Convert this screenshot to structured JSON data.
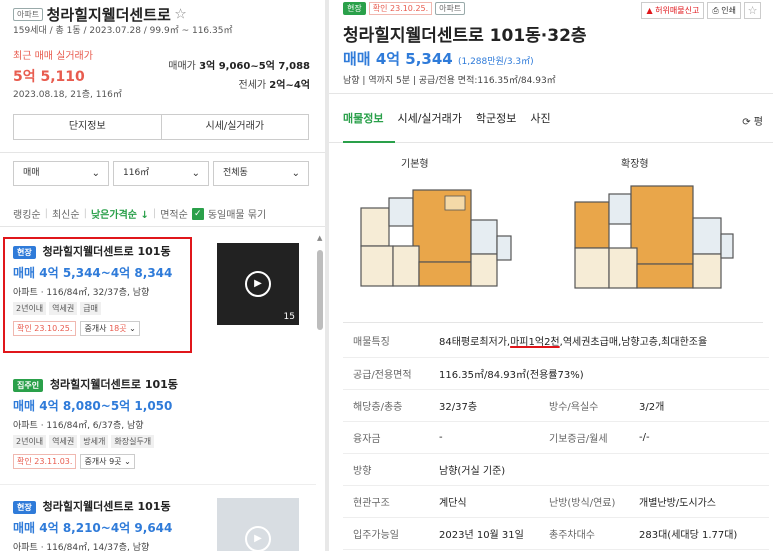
{
  "complex": {
    "type_tag": "아파트",
    "name": "청라힐지웰더센트로",
    "star": "☆",
    "summary": "159세대 / 총 1동 / 2023.07.28 / 99.9㎡ ~ 116.35㎡",
    "recent_label": "최근 매매 실거래가",
    "recent_price": "5억 5,110",
    "recent_date": "2023.08.18, 21층, 116㎡",
    "sale_label": "매매가",
    "sale_range": "3억 9,060~5억 7,088",
    "rent_label": "전세가",
    "rent_range": "2억~4억",
    "btn_info": "단지정보",
    "btn_price": "시세/실거래가"
  },
  "filters": {
    "trade": "매매",
    "area": "116㎡",
    "building": "전체동"
  },
  "sorts": {
    "ranking": "랭킹순",
    "latest": "최신순",
    "low_price": "낮은가격순",
    "low_price_arrow": "↓",
    "area": "면적순",
    "group": "동일매물 묶기"
  },
  "listings": [
    {
      "tag": "현장",
      "title": "청라힐지웰더센트로 101동",
      "price": "매매 4억 5,344~4억 8,344",
      "info": "아파트 · 116/84㎡, 32/37층, 남향",
      "chips": [
        "2년이내",
        "역세권",
        "급매"
      ],
      "confirm": "확인 23.10.25.",
      "agent_label": "중개사",
      "agent_count": "18곳",
      "thumb_count": "15"
    },
    {
      "tag": "집주인",
      "title": "청라힐지웰더센트로 101동",
      "price": "매매 4억 8,080~5억 1,050",
      "info": "아파트 · 116/84㎡, 6/37층, 남향",
      "chips": [
        "2년이내",
        "역세권",
        "방세개",
        "화장실두개"
      ],
      "confirm": "확인 23.11.03.",
      "agent_label": "중개사",
      "agent_count": "9곳"
    },
    {
      "tag": "현장",
      "title": "청라힐지웰더센트로 101동",
      "price": "매매 4억 8,210~4억 9,644",
      "info": "아파트 · 116/84㎡, 14/37층, 남향"
    }
  ],
  "detail": {
    "tag_site": "현장",
    "tag_confirm": "확인 23.10.25.",
    "tag_type": "아파트",
    "report": "허위매물신고",
    "print": "인쇄",
    "star": "☆",
    "title": "청라힐지웰더센트로 101동·32층",
    "price": "매매 4억 5,344",
    "price_per": "(1,288만원/3.3㎡)",
    "meta": "남향 | 역까지 5분 | 공급/전용 면적:116.35㎡/84.93㎡",
    "tabs": [
      "매물정보",
      "시세/실거래가",
      "학군정보",
      "사진"
    ],
    "pyeong": "평",
    "plan_basic": "기본형",
    "plan_ext": "확장형",
    "rows": [
      {
        "k": "매물특징",
        "v_pre": "84태평로최저가,",
        "v_hl": "마피1억2천",
        "v_post": ",역세권초급매,남향고층,최대한조율"
      },
      {
        "k": "공급/전용면적",
        "v": "116.35㎡/84.93㎡(전용률73%)"
      },
      {
        "k": "해당층/총층",
        "v": "32/37층",
        "k2": "방수/욕실수",
        "v2": "3/2개"
      },
      {
        "k": "융자금",
        "v": "-",
        "k2": "기보증금/월세",
        "v2": "-/-"
      },
      {
        "k": "방향",
        "v": "남향(거실 기준)"
      },
      {
        "k": "현관구조",
        "v": "계단식",
        "k2": "난방(방식/연료)",
        "v2": "개별난방/도시가스"
      },
      {
        "k": "입주가능일",
        "v": "2023년 10월 31일",
        "k2": "총주차대수",
        "v2": "283대(세대당 1.77대)"
      }
    ]
  },
  "colors": {
    "accent_green": "#2aa04a",
    "price_blue": "#2f7bd9",
    "alert_red": "#e85c4f",
    "highlight_red": "#e0161b"
  }
}
